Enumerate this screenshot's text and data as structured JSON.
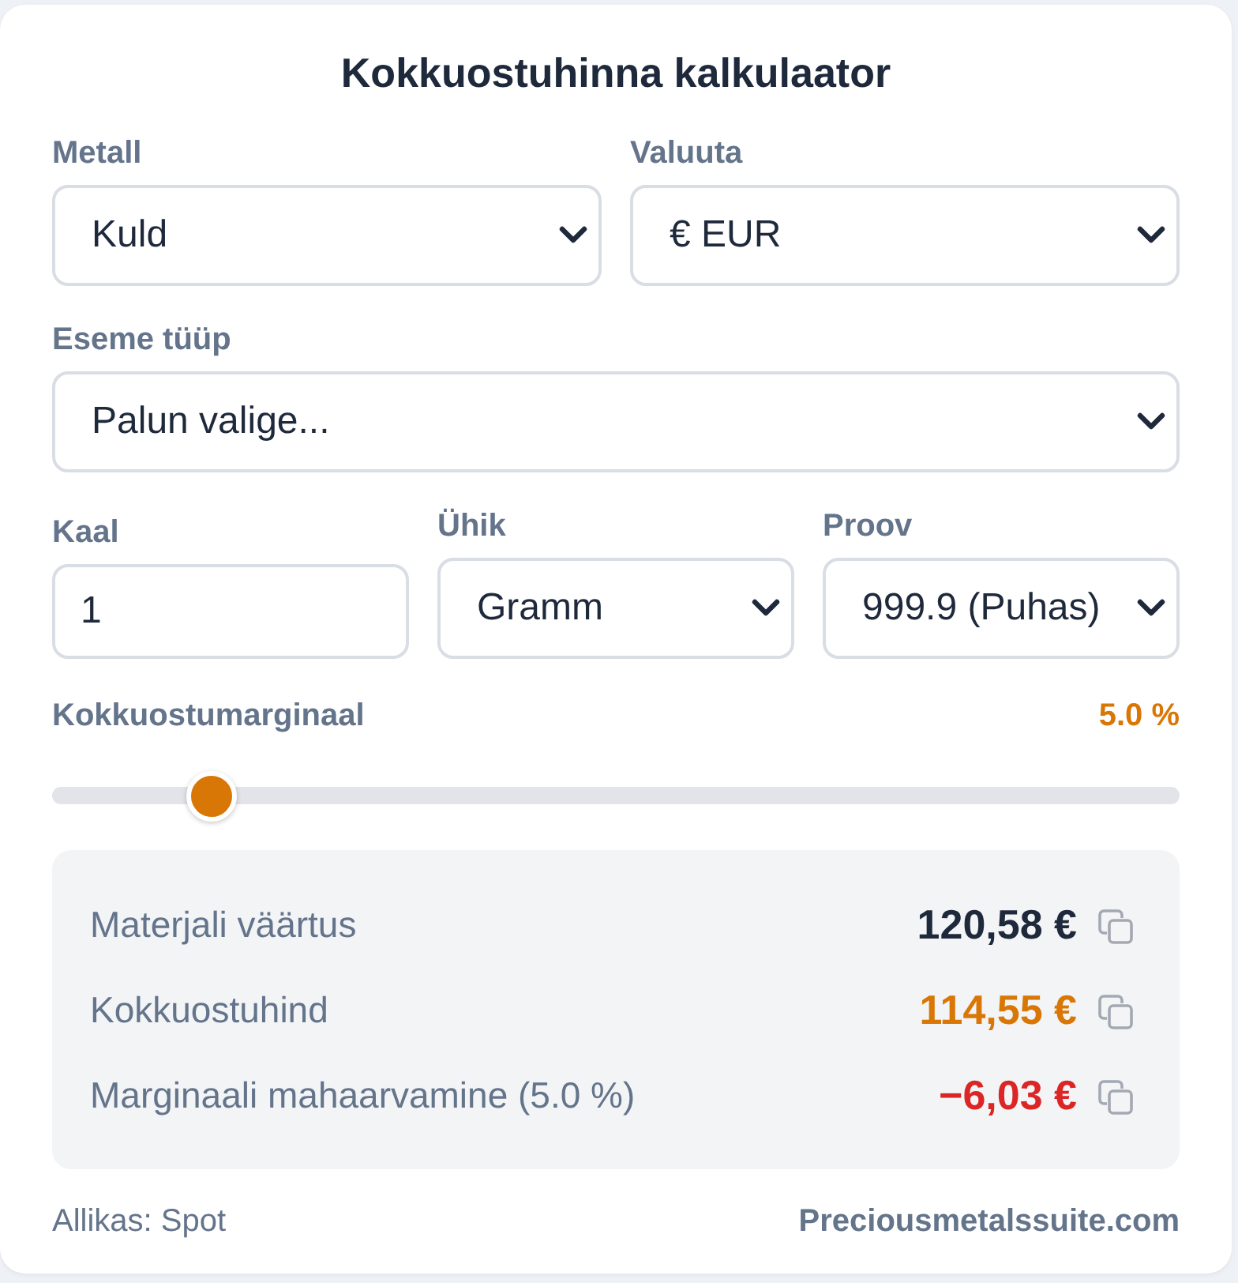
{
  "title": "Kokkuostuhinna kalkulaator",
  "field_rows": [
    [
      {
        "kind": "select",
        "label": "Metall",
        "value": "Kuld"
      },
      {
        "kind": "select",
        "label": "Valuuta",
        "value": "€ EUR"
      }
    ],
    [
      {
        "kind": "select",
        "label": "Eseme tüüp",
        "value": "Palun valige..."
      }
    ],
    [
      {
        "kind": "input",
        "label": "Kaal",
        "value": "1"
      },
      {
        "kind": "select",
        "label": "Ühik",
        "value": "Gramm"
      },
      {
        "kind": "select",
        "label": "Proov",
        "value": "999.9 (Puhas)"
      }
    ]
  ],
  "margin": {
    "label": "Kokkuostumarginaal",
    "reading": "5.0 %",
    "level": 0.125
  },
  "results": [
    {
      "label": "Materjali väärtus",
      "value": "120,58 €",
      "kind": "plain"
    },
    {
      "label": "Kokkuostuhind",
      "value": "114,55 €",
      "kind": "highlight"
    },
    {
      "label": "Marginaali mahaarvamine (5.0 %)",
      "value": "−6,03 €",
      "kind": "negative"
    }
  ],
  "footer": {
    "source": "Allikas: Spot",
    "link": "Preciousmetalssuite.com"
  }
}
